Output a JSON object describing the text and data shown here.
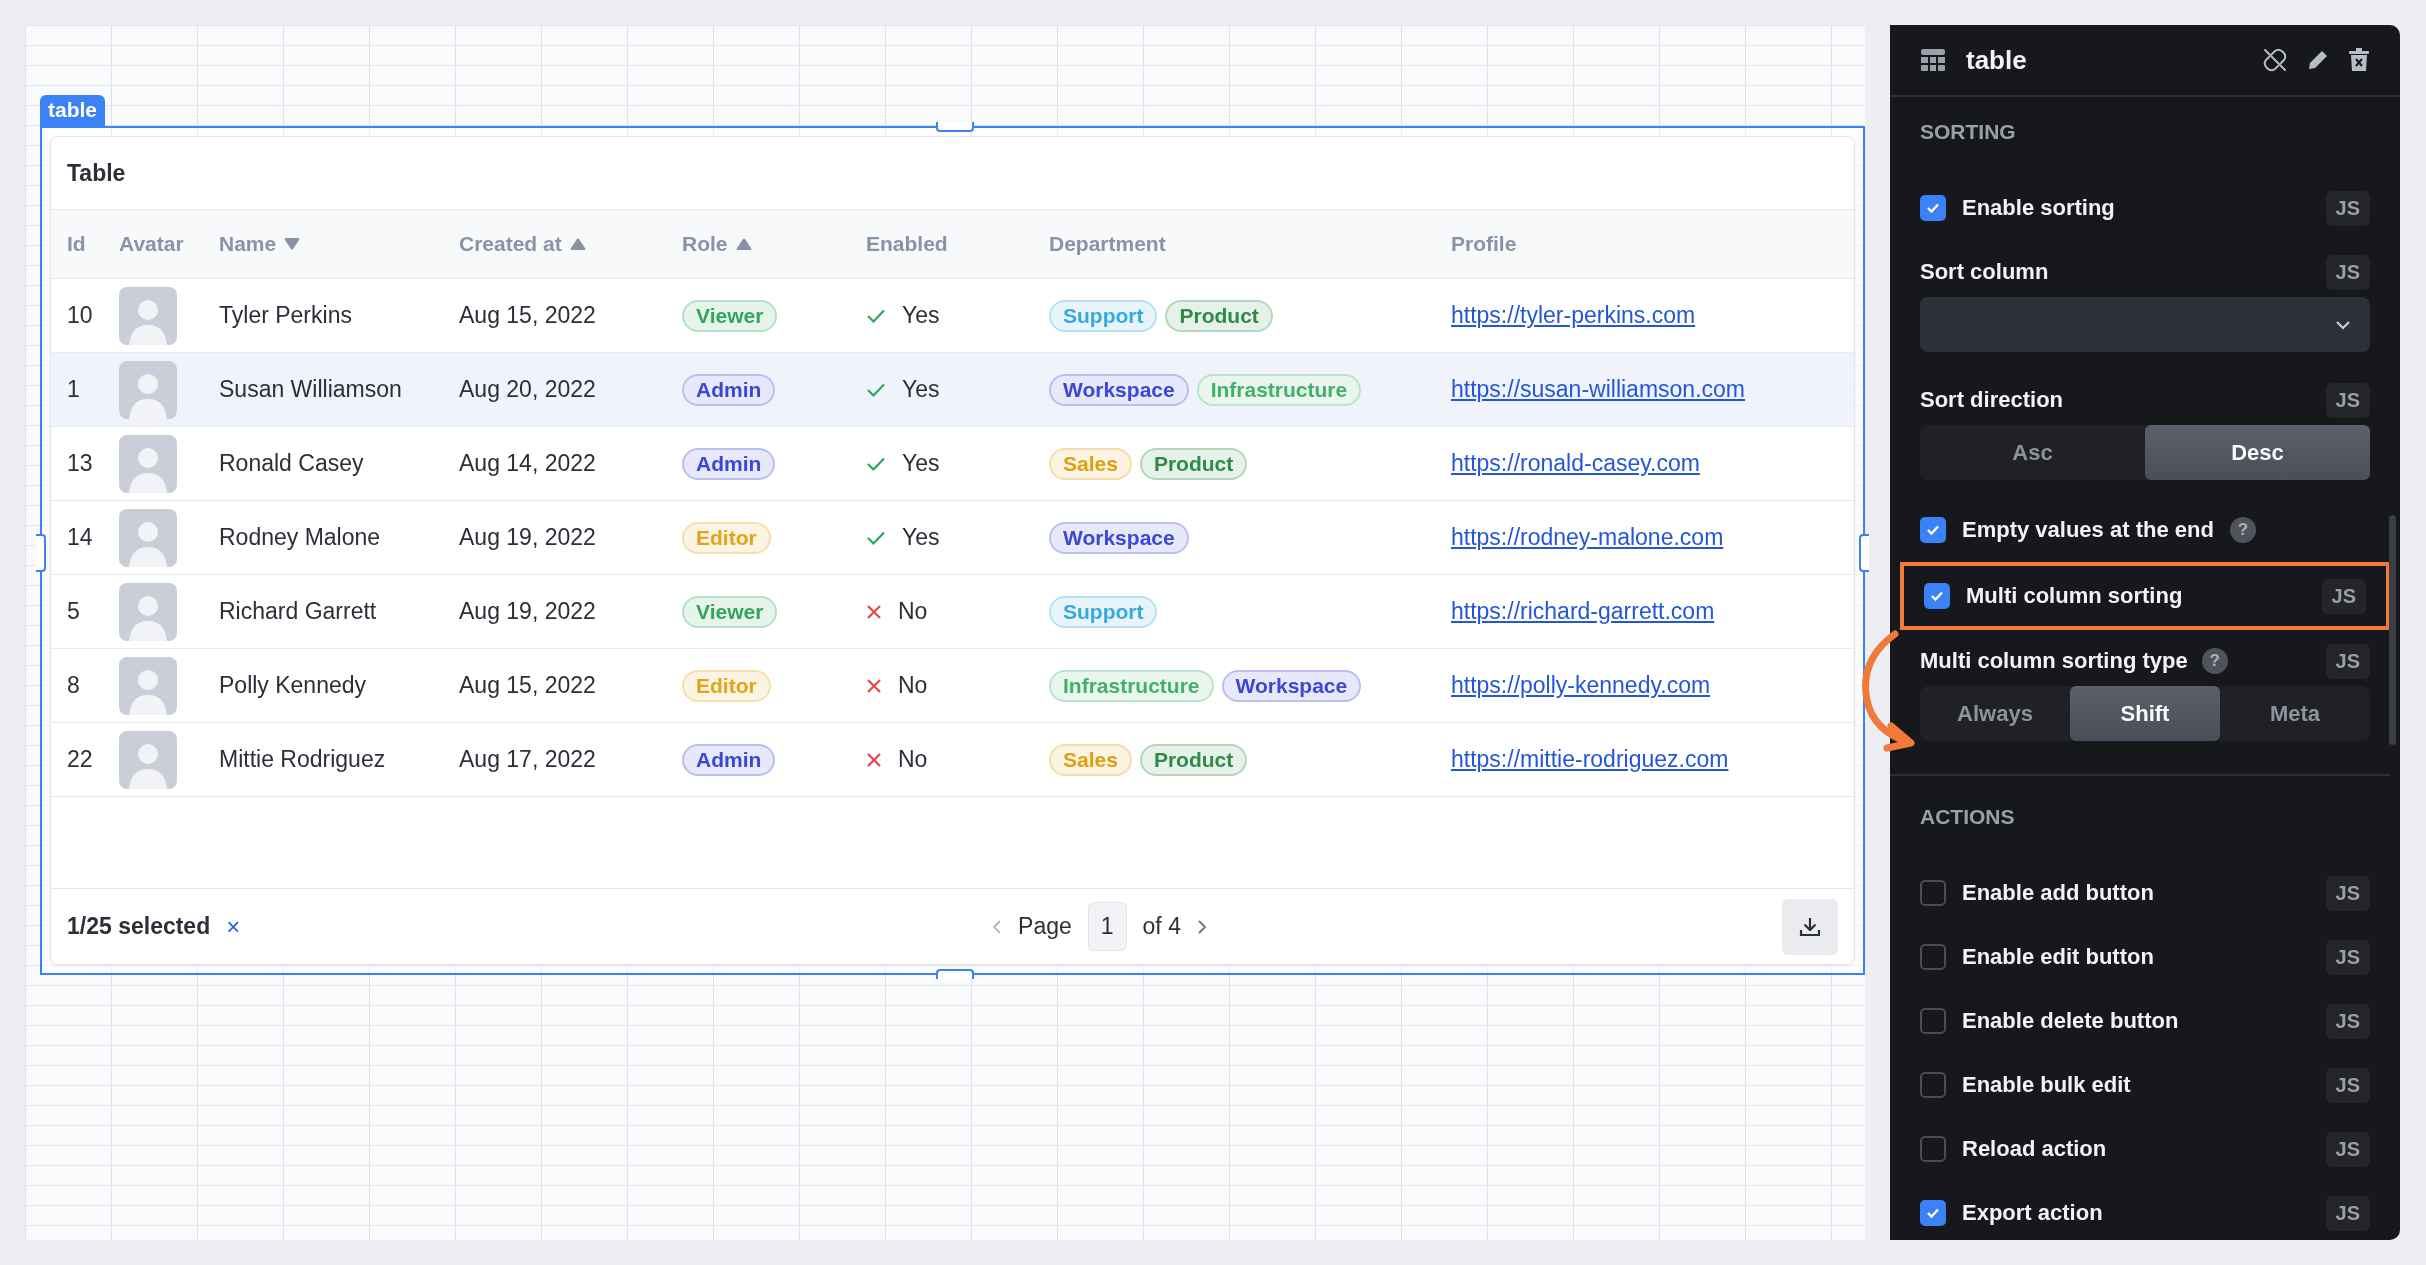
{
  "component_label": "table",
  "table": {
    "title": "Table",
    "columns": [
      {
        "label": "Id",
        "kind": "plain"
      },
      {
        "label": "Avatar",
        "kind": "plain"
      },
      {
        "label": "Name",
        "kind": "sorted_desc"
      },
      {
        "label": "Created at",
        "kind": "sorted_asc"
      },
      {
        "label": "Role",
        "kind": "sorted_asc"
      },
      {
        "label": "Enabled",
        "kind": "plain"
      },
      {
        "label": "Department",
        "kind": "plain"
      },
      {
        "label": "Profile",
        "kind": "plain"
      }
    ],
    "rows": [
      {
        "id": "10",
        "name": "Tyler Perkins",
        "created_at": "Aug 15, 2022",
        "role": {
          "label": "Viewer",
          "color": "#2fa65a"
        },
        "enabled": true,
        "enabled_text": "Yes",
        "departments": [
          {
            "label": "Support",
            "color": "#36a9de"
          },
          {
            "label": "Product",
            "color": "#2d8a47"
          }
        ],
        "profile": "https://tyler-perkins.com",
        "selected": false
      },
      {
        "id": "1",
        "name": "Susan Williamson",
        "created_at": "Aug 20, 2022",
        "role": {
          "label": "Admin",
          "color": "#3949d6"
        },
        "enabled": true,
        "enabled_text": "Yes",
        "departments": [
          {
            "label": "Workspace",
            "color": "#3949d6"
          },
          {
            "label": "Infrastructure",
            "color": "#43b069"
          }
        ],
        "profile": "https://susan-williamson.com",
        "selected": true
      },
      {
        "id": "13",
        "name": "Ronald Casey",
        "created_at": "Aug 14, 2022",
        "role": {
          "label": "Admin",
          "color": "#3949d6"
        },
        "enabled": true,
        "enabled_text": "Yes",
        "departments": [
          {
            "label": "Sales",
            "color": "#dca00c"
          },
          {
            "label": "Product",
            "color": "#2d8a47"
          }
        ],
        "profile": "https://ronald-casey.com",
        "selected": false
      },
      {
        "id": "14",
        "name": "Rodney Malone",
        "created_at": "Aug 19, 2022",
        "role": {
          "label": "Editor",
          "color": "#e2a418"
        },
        "enabled": true,
        "enabled_text": "Yes",
        "departments": [
          {
            "label": "Workspace",
            "color": "#3949d6"
          }
        ],
        "profile": "https://rodney-malone.com",
        "selected": false
      },
      {
        "id": "5",
        "name": "Richard Garrett",
        "created_at": "Aug 19, 2022",
        "role": {
          "label": "Viewer",
          "color": "#2fa65a"
        },
        "enabled": false,
        "enabled_text": "No",
        "departments": [
          {
            "label": "Support",
            "color": "#36a9de"
          }
        ],
        "profile": "https://richard-garrett.com",
        "selected": false
      },
      {
        "id": "8",
        "name": "Polly Kennedy",
        "created_at": "Aug 15, 2022",
        "role": {
          "label": "Editor",
          "color": "#e2a418"
        },
        "enabled": false,
        "enabled_text": "No",
        "departments": [
          {
            "label": "Infrastructure",
            "color": "#43b069"
          },
          {
            "label": "Workspace",
            "color": "#3949d6"
          }
        ],
        "profile": "https://polly-kennedy.com",
        "selected": false
      },
      {
        "id": "22",
        "name": "Mittie Rodriguez",
        "created_at": "Aug 17, 2022",
        "role": {
          "label": "Admin",
          "color": "#3949d6"
        },
        "enabled": false,
        "enabled_text": "No",
        "departments": [
          {
            "label": "Sales",
            "color": "#dca00c"
          },
          {
            "label": "Product",
            "color": "#2d8a47"
          }
        ],
        "profile": "https://mittie-rodriguez.com",
        "selected": false
      }
    ],
    "footer": {
      "selection": "1/25 selected",
      "clear": "×",
      "page_label": "Page",
      "page": "1",
      "page_total": "of 4"
    }
  },
  "panel": {
    "title": "table",
    "sections": [
      {
        "title": "SORTING",
        "items": [
          {
            "kind": "checkbox",
            "label": "Enable sorting",
            "checked": true,
            "badge": "JS"
          },
          {
            "kind": "select",
            "label": "Sort column",
            "badge": "JS"
          },
          {
            "kind": "segmented",
            "label": "Sort direction",
            "badge": "JS",
            "options": [
              {
                "label": "Asc",
                "selected": false
              },
              {
                "label": "Desc",
                "selected": true
              }
            ]
          },
          {
            "kind": "checkbox",
            "label": "Empty values at the end",
            "checked": true,
            "help": "?"
          },
          {
            "kind": "checkbox",
            "label": "Multi column sorting",
            "checked": true,
            "badge": "JS",
            "highlighted": true
          },
          {
            "kind": "segmented",
            "label": "Multi column sorting type",
            "help": "?",
            "badge": "JS",
            "options": [
              {
                "label": "Always",
                "selected": false
              },
              {
                "label": "Shift",
                "selected": true
              },
              {
                "label": "Meta",
                "selected": false
              }
            ]
          }
        ]
      },
      {
        "title": "ACTIONS",
        "items": [
          {
            "kind": "checkbox",
            "label": "Enable add button",
            "checked": false,
            "badge": "JS"
          },
          {
            "kind": "checkbox",
            "label": "Enable edit button",
            "checked": false,
            "badge": "JS"
          },
          {
            "kind": "checkbox",
            "label": "Enable delete button",
            "checked": false,
            "badge": "JS"
          },
          {
            "kind": "checkbox",
            "label": "Enable bulk edit",
            "checked": false,
            "badge": "JS"
          },
          {
            "kind": "checkbox",
            "label": "Reload action",
            "checked": false,
            "badge": "JS"
          },
          {
            "kind": "checkbox",
            "label": "Export action",
            "checked": true,
            "badge": "JS"
          }
        ]
      }
    ]
  }
}
